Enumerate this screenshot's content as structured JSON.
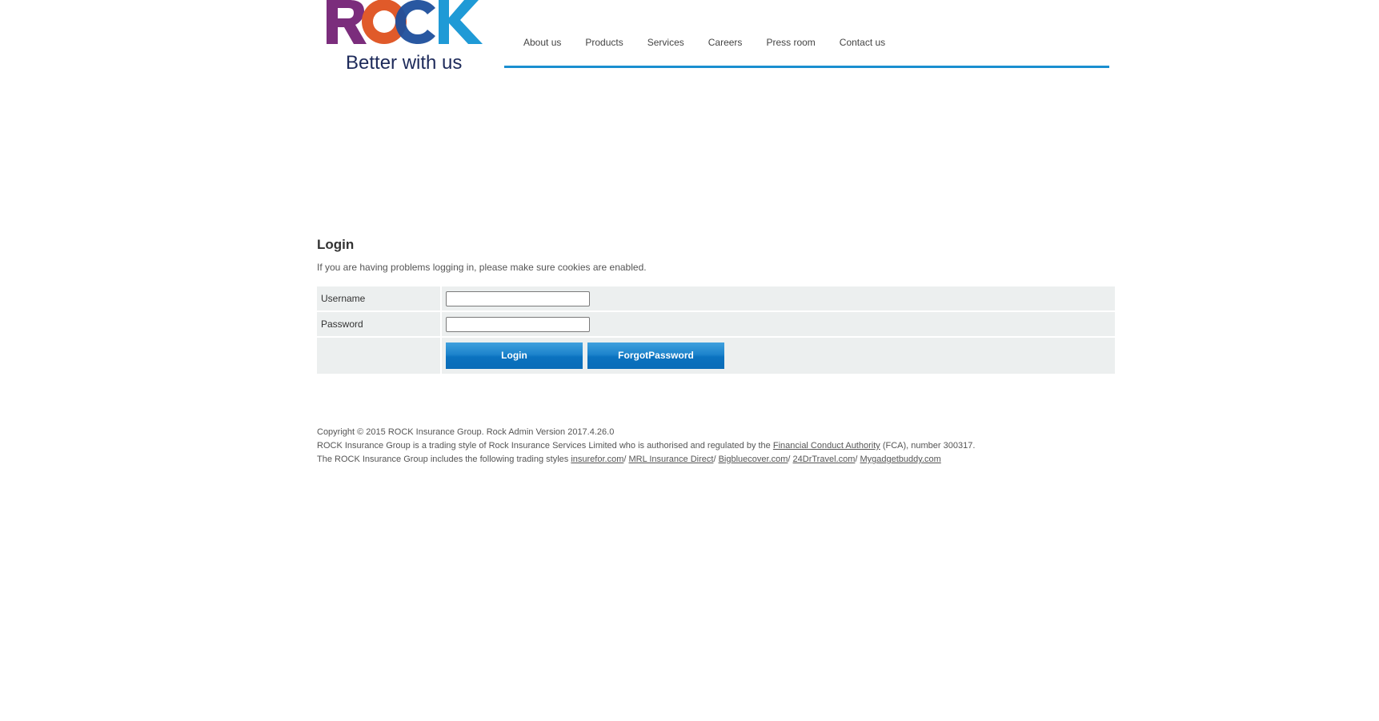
{
  "brand": {
    "logo_text": "ROCK",
    "tagline": "Better with us",
    "colors": {
      "R": "#7b2d7c",
      "O": "#e05a2a",
      "C": "#1d4f9c",
      "K": "#1f9ad6",
      "tagline": "#1d2a5a"
    }
  },
  "nav": {
    "items": [
      {
        "label": "About us"
      },
      {
        "label": "Products"
      },
      {
        "label": "Services"
      },
      {
        "label": "Careers"
      },
      {
        "label": "Press room"
      },
      {
        "label": "Contact us"
      }
    ],
    "accent_color": "#1a8fd0"
  },
  "login": {
    "title": "Login",
    "hint": "If you are having problems logging in, please make sure cookies are enabled.",
    "username_label": "Username",
    "username_value": "",
    "password_label": "Password",
    "password_value": "",
    "login_button": "Login",
    "forgot_button": "ForgotPassword"
  },
  "footer": {
    "line1": "Copyright © 2015 ROCK Insurance Group. Rock Admin Version 2017.4.26.0",
    "line2_prefix": "ROCK Insurance Group is a trading style of Rock Insurance Services Limited who is authorised and regulated by the ",
    "fca_link": "Financial Conduct Authority",
    "line2_suffix": " (FCA), number 300317.",
    "line3_prefix": "The ROCK Insurance Group includes the following trading styles ",
    "links": [
      {
        "label": "insurefor.com"
      },
      {
        "label": "MRL Insurance Direct"
      },
      {
        "label": "Bigbluecover.com"
      },
      {
        "label": "24DrTravel.com"
      },
      {
        "label": "Mygadgetbuddy.com"
      }
    ],
    "separator": "/ "
  }
}
